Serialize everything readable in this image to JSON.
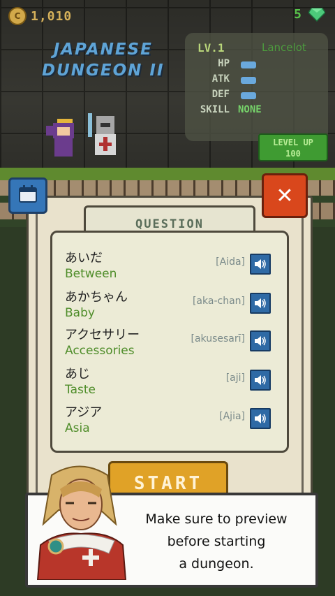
{
  "currency": {
    "coins": "1,010",
    "gems": "5"
  },
  "game_title": {
    "line1": "JAPANESE",
    "line2": "DUNGEON II"
  },
  "stats": {
    "level": "LV.1",
    "hero_name": "Lancelot",
    "rows": [
      {
        "label": "HP"
      },
      {
        "label": "ATK"
      },
      {
        "label": "DEF"
      },
      {
        "label": "SKILL",
        "value": "NONE"
      }
    ],
    "level_up": {
      "label": "LEVEL UP",
      "cost": "100"
    }
  },
  "question": {
    "title": "QUESTION",
    "words": [
      {
        "jp": "あいだ",
        "en": "Between",
        "romaji": "[Aida]"
      },
      {
        "jp": "あかちゃん",
        "en": "Baby",
        "romaji": "[aka-chan]"
      },
      {
        "jp": "アクセサリー",
        "en": "Accessories",
        "romaji": "[akusesarī]"
      },
      {
        "jp": "あじ",
        "en": "Taste",
        "romaji": "[aji]"
      },
      {
        "jp": "アジア",
        "en": "Asia",
        "romaji": "[Ajia]"
      }
    ]
  },
  "start_label": "START",
  "close_label": "✕",
  "tip": {
    "line1": "Make sure to preview",
    "line2": "before starting",
    "line3": "a dungeon."
  },
  "colors": {
    "accent_green": "#4f8d2a",
    "close_red": "#d9471c",
    "start_gold": "#e0a227",
    "speaker_blue": "#2f6aa5"
  }
}
